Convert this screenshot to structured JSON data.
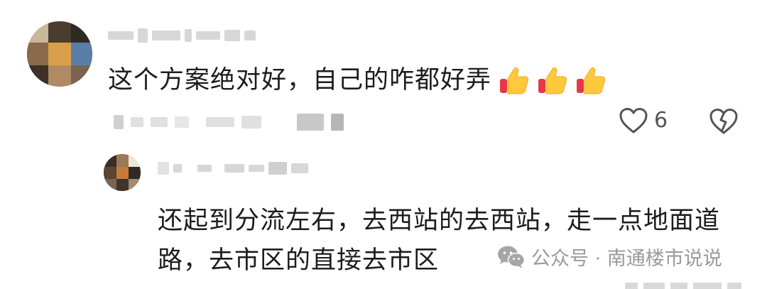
{
  "comment": {
    "text": "这个方案绝对好，自己的咋都好弄",
    "emoji_icons": [
      "thumbs-up-icon",
      "thumbs-up-icon",
      "thumbs-up-icon"
    ],
    "like_count": "6"
  },
  "reply": {
    "text": "还起到分流左右，去西站的去西站，走一点地面道路，去市区的直接去市区"
  },
  "watermark": {
    "text": "公众号 · 南通楼市说说",
    "icon": "wechat-icon"
  },
  "colors": {
    "text": "#1c1c1c",
    "icon_gray": "#555555",
    "watermark_gray": "#9a9a9a",
    "thumb_yellow": "#ffc83d",
    "thumb_red": "#e8374a"
  }
}
